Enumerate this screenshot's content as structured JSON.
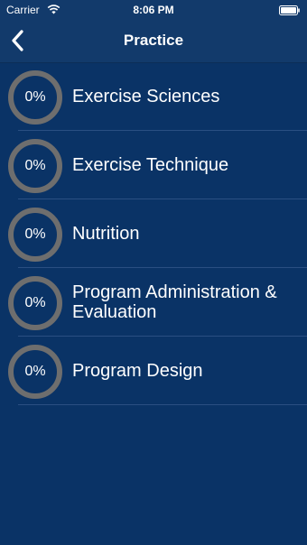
{
  "status_bar": {
    "carrier": "Carrier",
    "time": "8:06 PM",
    "wifi_icon": "wifi-icon",
    "battery_icon": "battery-icon"
  },
  "nav": {
    "title": "Practice",
    "back_icon": "chevron-left-icon"
  },
  "colors": {
    "background": "#0a3366",
    "nav_background": "#123a6b",
    "ring": "#6e6e6e",
    "text": "#ffffff"
  },
  "categories": [
    {
      "label": "Exercise Sciences",
      "progress_text": "0%",
      "progress": 0
    },
    {
      "label": "Exercise Technique",
      "progress_text": "0%",
      "progress": 0
    },
    {
      "label": "Nutrition",
      "progress_text": "0%",
      "progress": 0
    },
    {
      "label": "Program Administration & Evaluation",
      "progress_text": "0%",
      "progress": 0
    },
    {
      "label": "Program Design",
      "progress_text": "0%",
      "progress": 0
    }
  ]
}
